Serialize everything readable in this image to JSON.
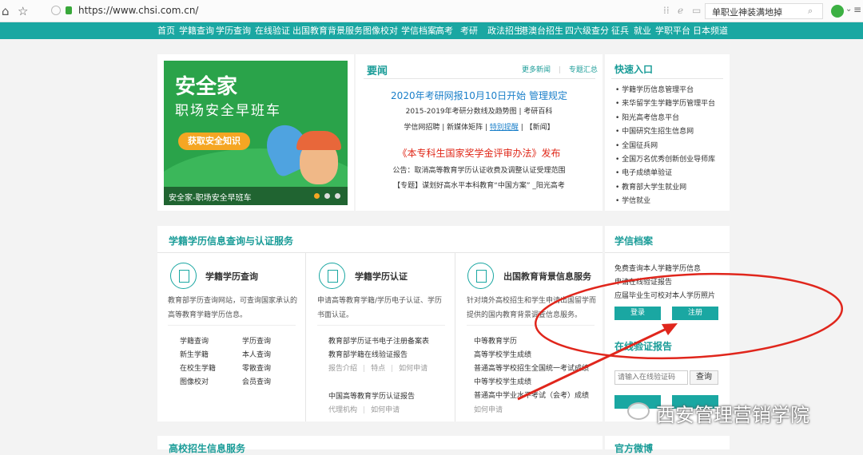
{
  "browser": {
    "url": "https://www.chsi.com.cn/",
    "search_text": "单职业神装满地掉"
  },
  "nav": [
    "首页",
    "学籍查询",
    "学历查询",
    "在线验证",
    "出国教育背景服务",
    "图像校对",
    "学信档案",
    "高考",
    "考研",
    "政法招生",
    "港澳台招生",
    "四六级查分",
    "征兵",
    "就业",
    "学职平台",
    "日本频道"
  ],
  "banner": {
    "title": "安全家",
    "subtitle": "职场安全早班车",
    "button": "获取安全知识",
    "caption": "安全家-职场安全早班车"
  },
  "news": {
    "heading": "要闻",
    "more": "更多新闻",
    "topics": "专题汇总",
    "headline1": "2020年考研网报10月10日开始 管理规定",
    "line1": "2015-2019年考研分数线及趋势图 | 考研百科",
    "line2a": "学信网招聘 | 新媒体矩阵 | ",
    "line2b": "特別提醒",
    "line2c": " | 【新闻】",
    "headline2": "《本专科生国家奖学金评审办法》发布",
    "line3": "公告：取消高等教育学历认证收费及调整认证受理范围",
    "line4": "【专题】谋划好高水平本科教育“中国方案” _阳光高考"
  },
  "quick": {
    "heading": "快速入口",
    "items": [
      "学籍学历信息管理平台",
      "来华留学生学籍学历管理平台",
      "阳光高考信息平台",
      "中国研究生招生信息网",
      "全国征兵网",
      "全国万名优秀创新创业导师库",
      "电子成绩单验证",
      "教育部大学生就业网",
      "学信就业"
    ]
  },
  "services": {
    "heading": "学籍学历信息查询与认证服务",
    "col1": {
      "title": "学籍学历查询",
      "desc1": "教育部学历查询网站，可查询国家承认的",
      "desc2": "高等教育学籍学历信息。",
      "links": [
        "学籍查询",
        "学历查询",
        "新生学籍",
        "本人查询",
        "在校生学籍",
        "零散查询",
        "图像校对",
        "会员查询"
      ]
    },
    "col2": {
      "title": "学籍学历认证",
      "desc1": "申请高等教育学籍/学历电子认证、学历",
      "desc2": "书面认证。",
      "link1": "教育部学历证书电子注册备案表",
      "link2": "教育部学籍在线验证报告",
      "sub1": [
        "报告介绍",
        "特点",
        "如何申请"
      ],
      "link3": "中国高等教育学历认证报告",
      "sub2": [
        "代理机构",
        "如何申请"
      ]
    },
    "col3": {
      "title": "出国教育背景信息服务",
      "desc1": "针对境外高校招生和学生申请出国留学而",
      "desc2": "提供的国内教育背景调查信息服务。",
      "links": [
        "中等教育学历",
        "高等学校学生成绩",
        "普通高等学校招生全国统一考试成绩",
        "中等学校学生成绩",
        "普通高中学业水平考试（会考）成绩"
      ],
      "apply": "如何申请"
    }
  },
  "archive": {
    "heading": "学信档案",
    "line1": "免费查询本人学籍学历信息",
    "line2": "申请在线验证报告",
    "line3": "应届毕业生可校对本人学历照片",
    "login": "登录",
    "register": "注册",
    "verify_heading": "在线验证报告",
    "verify_placeholder": "请输入在线验证码",
    "query": "查询"
  },
  "bottom": {
    "left_heading": "高校招生信息服务",
    "right_heading": "官方微博"
  },
  "watermark": "西安管理营销学院"
}
